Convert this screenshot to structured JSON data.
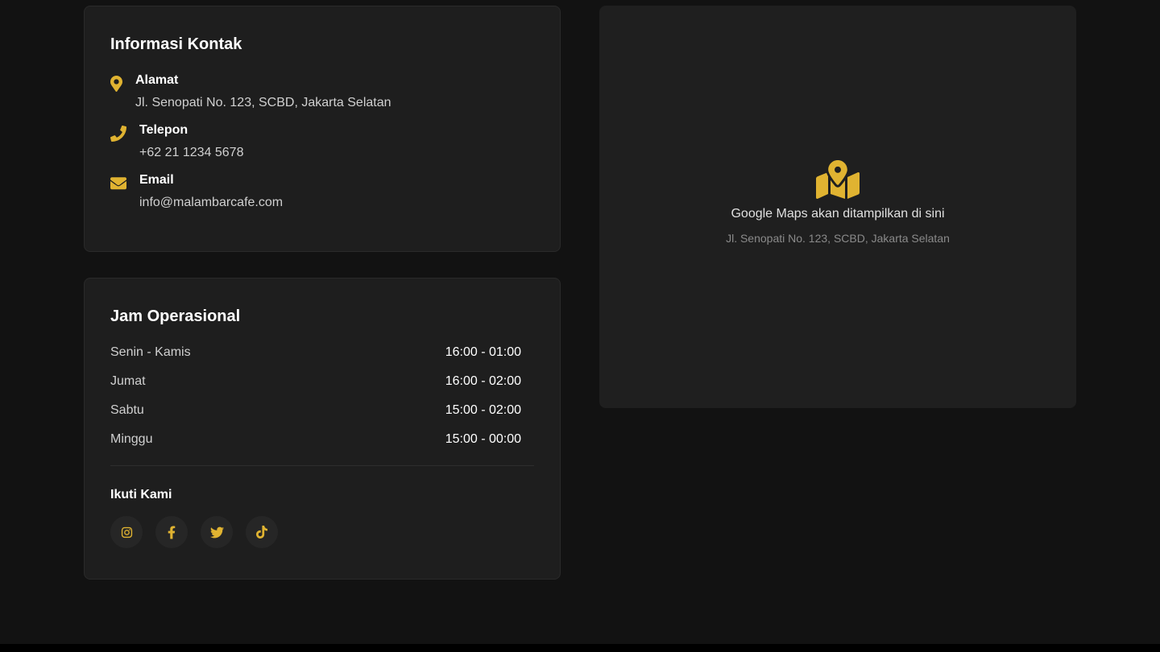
{
  "colors": {
    "accent": "#e0b331",
    "background": "#121212",
    "card": "#1e1e1e"
  },
  "contact": {
    "title": "Informasi Kontak",
    "items": [
      {
        "icon": "map-pin-icon",
        "label": "Alamat",
        "value": "Jl. Senopati No. 123, SCBD, Jakarta Selatan"
      },
      {
        "icon": "phone-icon",
        "label": "Telepon",
        "value": "+62 21 1234 5678"
      },
      {
        "icon": "envelope-icon",
        "label": "Email",
        "value": "info@malambarcafe.com"
      }
    ]
  },
  "hours": {
    "title": "Jam Operasional",
    "rows": [
      {
        "day": "Senin - Kamis",
        "time": "16:00 - 01:00"
      },
      {
        "day": "Jumat",
        "time": "16:00 - 02:00"
      },
      {
        "day": "Sabtu",
        "time": "15:00 - 02:00"
      },
      {
        "day": "Minggu",
        "time": "15:00 - 00:00"
      }
    ],
    "follow_title": "Ikuti Kami",
    "social": [
      {
        "icon": "instagram-icon"
      },
      {
        "icon": "facebook-icon"
      },
      {
        "icon": "twitter-icon"
      },
      {
        "icon": "tiktok-icon"
      }
    ]
  },
  "map": {
    "icon": "map-location-icon",
    "placeholder_text": "Google Maps akan ditampilkan di sini",
    "address": "Jl. Senopati No. 123, SCBD, Jakarta Selatan"
  }
}
